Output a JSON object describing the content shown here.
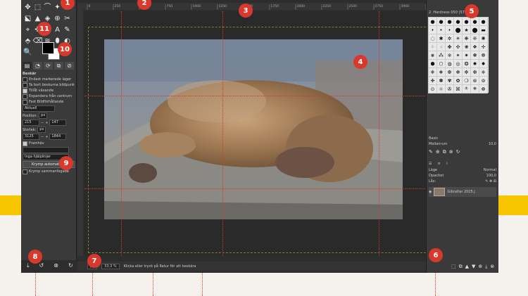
{
  "toolbox": {
    "tools": [
      "✥",
      "⬚",
      "⌒",
      "✦",
      "⤢",
      "⬕",
      "▲",
      "◈",
      "⊕",
      "✂",
      "⌖",
      "✜",
      "",
      "A",
      "✎",
      "⬘",
      "⌫",
      "≋",
      "⬮",
      "◐",
      "🔍"
    ],
    "tab_icons": [
      "▤",
      "◔",
      "⟳",
      "⧉",
      "⊘"
    ],
    "options": {
      "section_label": "Beskär",
      "checkboxes": [
        {
          "label": "Endast markerade lager",
          "checked": false
        },
        {
          "label": "Ta bort beskurna bildpunkter",
          "checked": false
        },
        {
          "label": "Tillåt växande",
          "checked": true
        },
        {
          "label": "Expandera från centrum",
          "checked": false
        },
        {
          "label": "Fast Bildförhållande",
          "checked": false
        }
      ],
      "current_label": "Aktuell",
      "position_label": "Position:",
      "position_unit": "px",
      "position_x": "215",
      "position_y": "147",
      "size_label": "Storlek:",
      "size_unit": "px",
      "size_w": "3125",
      "size_h": "1844",
      "highlight_label": "Framhäv",
      "guides_value": "Inga hjälplinjer",
      "shrink_button": "Krymp automatiskt",
      "shrink_merged": "Krymp sammanfogade"
    },
    "bottom_icons": [
      "⤓",
      "↺",
      "⊗",
      "↻"
    ]
  },
  "canvas": {
    "ruler_marks": [
      "0",
      "250",
      "500",
      "750",
      "1000",
      "1250",
      "1500",
      "1750",
      "2000",
      "2250",
      "2500",
      "2750",
      "3000",
      "3250"
    ]
  },
  "statusbar": {
    "unit": "px",
    "zoom": "33,3 %",
    "hint": "Klicka eller tryck på Retur för att beskära"
  },
  "dock": {
    "brush_header": "2. Hardness 050 (57 × 57)",
    "brush_icons": [
      "●",
      "●",
      "●",
      "●",
      "●",
      "●",
      "●",
      "•",
      "•",
      "•",
      "⬤",
      "★",
      "⬤",
      "▬",
      "◌",
      "✱",
      "✲",
      "✳",
      "❋",
      "❊",
      "✺",
      "⁘",
      "⁖",
      "✤",
      "✣",
      "❀",
      "❖",
      "✢",
      "⋇",
      "⁂",
      "※",
      "✴",
      "✷",
      "❃",
      "❁",
      "⬢",
      "⬡",
      "◍",
      "◎",
      "❂",
      "✹",
      "✸",
      "❄",
      "❅",
      "❆",
      "✻",
      "✼",
      "❇",
      "❈",
      "❉",
      "✽",
      "✾",
      "✿",
      "❍",
      "⊛",
      "⊚",
      "⊙",
      "☼",
      "✇",
      "⌘",
      "⍟",
      "⎈",
      "☸"
    ],
    "basic_label": "Basic",
    "spacing_label": "Mellanrum",
    "spacing_value": "10,0",
    "layers": {
      "mode_label": "Läge",
      "mode_value": "Normal",
      "opacity_label": "Opacitet",
      "opacity_value": "100,0",
      "lock_label": "Lås:",
      "layer_name": "Gibraltar 2025.j"
    },
    "bottom_icons": [
      "⬚",
      "⧉",
      "▲",
      "▼",
      "⊕",
      "⤓",
      "⊗"
    ]
  },
  "callouts": [
    "1",
    "2",
    "3",
    "4",
    "5",
    "6",
    "7",
    "8",
    "9",
    "10",
    "11"
  ]
}
